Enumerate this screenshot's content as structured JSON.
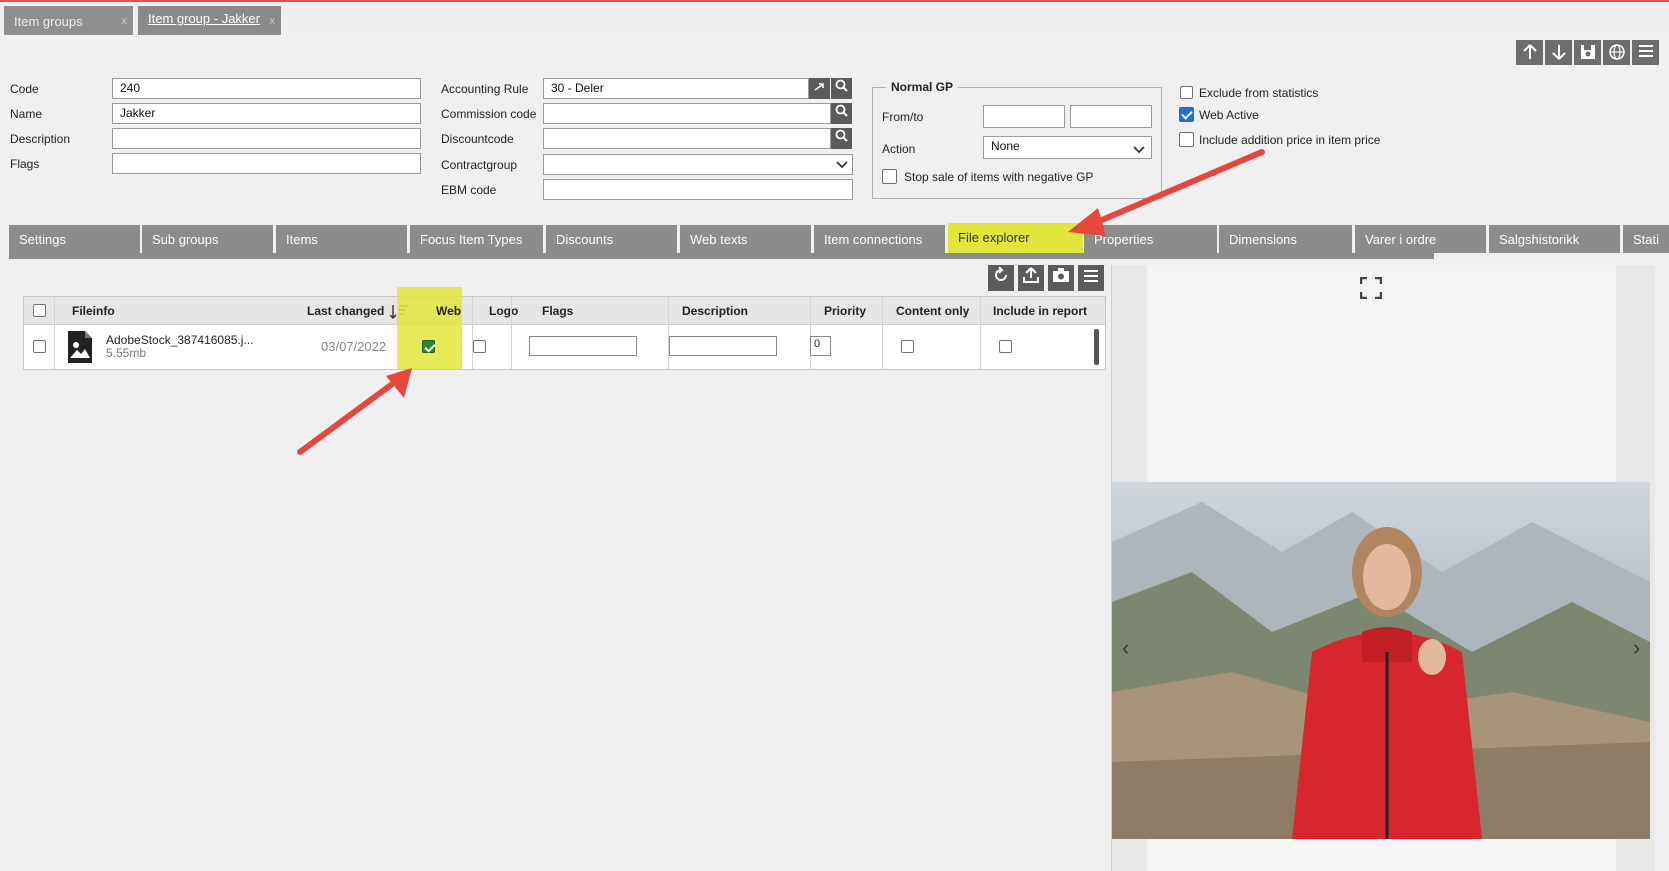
{
  "window_tabs": [
    {
      "label": "Item groups",
      "close": "x"
    },
    {
      "label": "Item group - Jakker",
      "close": "x"
    }
  ],
  "toolbar": {
    "icons": [
      "arrow-up-icon",
      "arrow-down-icon",
      "save-icon",
      "globe-icon",
      "menu-icon"
    ]
  },
  "form": {
    "code_label": "Code",
    "code_value": "240",
    "name_label": "Name",
    "name_value": "Jakker",
    "description_label": "Description",
    "description_value": "",
    "flags_label": "Flags",
    "flags_value": "",
    "accounting_rule_label": "Accounting Rule",
    "accounting_rule_value": "30 - Deler",
    "commission_label": "Commission code",
    "commission_value": "",
    "discountcode_label": "Discountcode",
    "discountcode_value": "",
    "contractgroup_label": "Contractgroup",
    "contractgroup_value": "",
    "ebm_label": "EBM code",
    "ebm_value": ""
  },
  "normal_gp": {
    "legend": "Normal GP",
    "fromto_label": "From/to",
    "action_label": "Action",
    "action_value": "None",
    "stop_sale_label": "Stop sale of items with negative GP",
    "stop_sale_checked": false
  },
  "options": {
    "exclude_stats_label": "Exclude from statistics",
    "exclude_stats_checked": false,
    "web_active_label": "Web Active",
    "web_active_checked": true,
    "include_addition_label": "Include addition price in item price",
    "include_addition_checked": false
  },
  "tabs": [
    "Settings",
    "Sub groups",
    "Items",
    "Focus Item Types",
    "Discounts",
    "Web texts",
    "Item connections",
    "File explorer",
    "Properties",
    "Dimensions",
    "Varer i ordre",
    "Salgshistorikk",
    "Stati"
  ],
  "active_tab": "File explorer",
  "grid": {
    "headers": {
      "fileinfo": "Fileinfo",
      "last_changed": "Last changed",
      "web": "Web",
      "logo": "Logo",
      "flags": "Flags",
      "description": "Description",
      "priority": "Priority",
      "content_only": "Content only",
      "include_in_report": "Include in report"
    },
    "rows": [
      {
        "filename": "AdobeStock_387416085.j...",
        "size": "5.55mb",
        "last_changed": "03/07/2022",
        "web": true,
        "logo": false,
        "flags": "",
        "description": "",
        "priority": "0",
        "content_only": false,
        "include_in_report": false
      }
    ]
  },
  "preview": {
    "prev_nav": "‹",
    "next_nav": "›"
  },
  "colors": {
    "highlight": "#e2e63c",
    "tab_gray": "#8c8c8c",
    "annotation_arrow": "#e5473c",
    "checkbox_blue": "#1e6fd9"
  }
}
